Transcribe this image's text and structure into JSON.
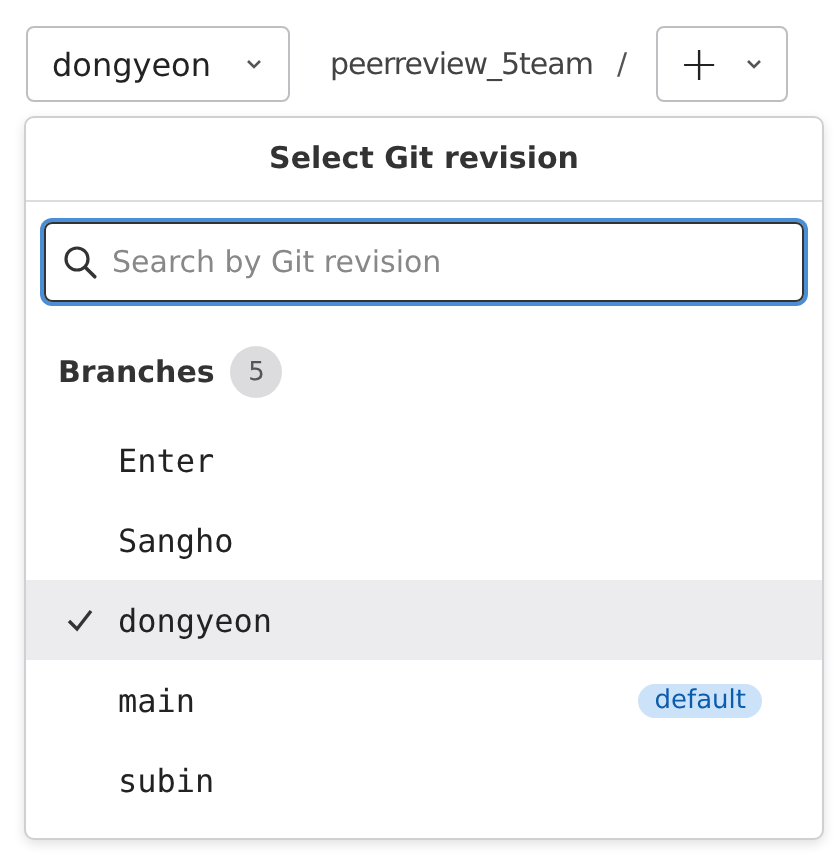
{
  "toolbar": {
    "branch_button": {
      "label": "dongyeon"
    },
    "path": "peerreview_5team",
    "separator": "/",
    "add_button": {
      "label": "+"
    }
  },
  "dropdown": {
    "title": "Select Git revision",
    "search": {
      "placeholder": "Search by Git revision"
    },
    "section": {
      "label": "Branches",
      "count": "5"
    },
    "items": [
      {
        "name": "Enter",
        "selected": false
      },
      {
        "name": "Sangho",
        "selected": false
      },
      {
        "name": "dongyeon",
        "selected": true
      },
      {
        "name": "main",
        "selected": false,
        "badge": "default"
      },
      {
        "name": "subin",
        "selected": false
      }
    ]
  }
}
